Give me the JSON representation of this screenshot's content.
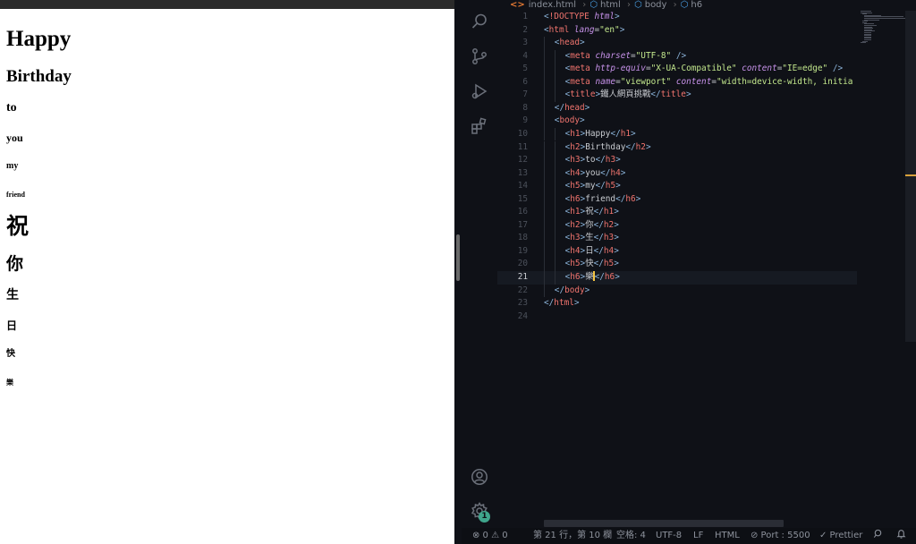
{
  "browser": {
    "headings": [
      {
        "tag": "h1",
        "text": "Happy"
      },
      {
        "tag": "h2",
        "text": "Birthday"
      },
      {
        "tag": "h3",
        "text": "to"
      },
      {
        "tag": "h4",
        "text": "you"
      },
      {
        "tag": "h5",
        "text": "my"
      },
      {
        "tag": "h6",
        "text": "friend"
      },
      {
        "tag": "h1",
        "text": "祝"
      },
      {
        "tag": "h2",
        "text": "你"
      },
      {
        "tag": "h3",
        "text": "生"
      },
      {
        "tag": "h4",
        "text": "日"
      },
      {
        "tag": "h5",
        "text": "快"
      },
      {
        "tag": "h6",
        "text": "樂"
      }
    ]
  },
  "breadcrumb": {
    "file_icon": "<>",
    "file": "index.html",
    "items": [
      "html",
      "body",
      "h6"
    ]
  },
  "activity_bar": {
    "icons": [
      "search-icon",
      "source-control-icon",
      "run-debug-icon",
      "extensions-icon",
      "account-icon",
      "settings-gear-icon"
    ],
    "badge": "1"
  },
  "editor": {
    "current_line": 21,
    "line_numbers": [
      "1",
      "2",
      "3",
      "4",
      "5",
      "6",
      "7",
      "8",
      "9",
      "10",
      "11",
      "12",
      "13",
      "14",
      "15",
      "16",
      "17",
      "18",
      "19",
      "20",
      "21",
      "22",
      "23",
      "24"
    ],
    "lines": [
      {
        "indent": 0,
        "tokens": [
          [
            "br",
            "<"
          ],
          [
            "tag",
            "!DOCTYPE "
          ],
          [
            "attr",
            "html"
          ],
          [
            "br",
            ">"
          ]
        ]
      },
      {
        "indent": 0,
        "tokens": [
          [
            "br",
            "<"
          ],
          [
            "tag",
            "html "
          ],
          [
            "attr",
            "lang"
          ],
          [
            "text",
            "="
          ],
          [
            "str",
            "\"en\""
          ],
          [
            "br",
            ">"
          ]
        ]
      },
      {
        "indent": 1,
        "tokens": [
          [
            "br",
            "<"
          ],
          [
            "tag",
            "head"
          ],
          [
            "br",
            ">"
          ]
        ]
      },
      {
        "indent": 2,
        "tokens": [
          [
            "br",
            "<"
          ],
          [
            "tag",
            "meta "
          ],
          [
            "attr",
            "charset"
          ],
          [
            "text",
            "="
          ],
          [
            "str",
            "\"UTF-8\""
          ],
          [
            "br",
            " />"
          ]
        ]
      },
      {
        "indent": 2,
        "tokens": [
          [
            "br",
            "<"
          ],
          [
            "tag",
            "meta "
          ],
          [
            "attr",
            "http-equiv"
          ],
          [
            "text",
            "="
          ],
          [
            "str",
            "\"X-UA-Compatible\""
          ],
          [
            "text",
            " "
          ],
          [
            "attr",
            "content"
          ],
          [
            "text",
            "="
          ],
          [
            "str",
            "\"IE=edge\""
          ],
          [
            "br",
            " />"
          ]
        ]
      },
      {
        "indent": 2,
        "tokens": [
          [
            "br",
            "<"
          ],
          [
            "tag",
            "meta "
          ],
          [
            "attr",
            "name"
          ],
          [
            "text",
            "="
          ],
          [
            "str",
            "\"viewport\""
          ],
          [
            "text",
            " "
          ],
          [
            "attr",
            "content"
          ],
          [
            "text",
            "="
          ],
          [
            "str",
            "\"width=device-width, initia"
          ]
        ]
      },
      {
        "indent": 2,
        "tokens": [
          [
            "br",
            "<"
          ],
          [
            "tag",
            "title"
          ],
          [
            "br",
            ">"
          ],
          [
            "text",
            "鐵人網頁挑戰"
          ],
          [
            "br",
            "</"
          ],
          [
            "tag",
            "title"
          ],
          [
            "br",
            ">"
          ]
        ]
      },
      {
        "indent": 1,
        "tokens": [
          [
            "br",
            "</"
          ],
          [
            "tag",
            "head"
          ],
          [
            "br",
            ">"
          ]
        ]
      },
      {
        "indent": 1,
        "tokens": [
          [
            "br",
            "<"
          ],
          [
            "tag",
            "body"
          ],
          [
            "br",
            ">"
          ]
        ]
      },
      {
        "indent": 2,
        "tokens": [
          [
            "br",
            "<"
          ],
          [
            "tag",
            "h1"
          ],
          [
            "br",
            ">"
          ],
          [
            "text",
            "Happy"
          ],
          [
            "br",
            "</"
          ],
          [
            "tag",
            "h1"
          ],
          [
            "br",
            ">"
          ]
        ]
      },
      {
        "indent": 2,
        "tokens": [
          [
            "br",
            "<"
          ],
          [
            "tag",
            "h2"
          ],
          [
            "br",
            ">"
          ],
          [
            "text",
            "Birthday"
          ],
          [
            "br",
            "</"
          ],
          [
            "tag",
            "h2"
          ],
          [
            "br",
            ">"
          ]
        ]
      },
      {
        "indent": 2,
        "tokens": [
          [
            "br",
            "<"
          ],
          [
            "tag",
            "h3"
          ],
          [
            "br",
            ">"
          ],
          [
            "text",
            "to"
          ],
          [
            "br",
            "</"
          ],
          [
            "tag",
            "h3"
          ],
          [
            "br",
            ">"
          ]
        ]
      },
      {
        "indent": 2,
        "tokens": [
          [
            "br",
            "<"
          ],
          [
            "tag",
            "h4"
          ],
          [
            "br",
            ">"
          ],
          [
            "text",
            "you"
          ],
          [
            "br",
            "</"
          ],
          [
            "tag",
            "h4"
          ],
          [
            "br",
            ">"
          ]
        ]
      },
      {
        "indent": 2,
        "tokens": [
          [
            "br",
            "<"
          ],
          [
            "tag",
            "h5"
          ],
          [
            "br",
            ">"
          ],
          [
            "text",
            "my"
          ],
          [
            "br",
            "</"
          ],
          [
            "tag",
            "h5"
          ],
          [
            "br",
            ">"
          ]
        ]
      },
      {
        "indent": 2,
        "tokens": [
          [
            "br",
            "<"
          ],
          [
            "tag",
            "h6"
          ],
          [
            "br",
            ">"
          ],
          [
            "text",
            "friend"
          ],
          [
            "br",
            "</"
          ],
          [
            "tag",
            "h6"
          ],
          [
            "br",
            ">"
          ]
        ]
      },
      {
        "indent": 2,
        "tokens": [
          [
            "br",
            "<"
          ],
          [
            "tag",
            "h1"
          ],
          [
            "br",
            ">"
          ],
          [
            "text",
            "祝"
          ],
          [
            "br",
            "</"
          ],
          [
            "tag",
            "h1"
          ],
          [
            "br",
            ">"
          ]
        ]
      },
      {
        "indent": 2,
        "tokens": [
          [
            "br",
            "<"
          ],
          [
            "tag",
            "h2"
          ],
          [
            "br",
            ">"
          ],
          [
            "text",
            "你"
          ],
          [
            "br",
            "</"
          ],
          [
            "tag",
            "h2"
          ],
          [
            "br",
            ">"
          ]
        ]
      },
      {
        "indent": 2,
        "tokens": [
          [
            "br",
            "<"
          ],
          [
            "tag",
            "h3"
          ],
          [
            "br",
            ">"
          ],
          [
            "text",
            "生"
          ],
          [
            "br",
            "</"
          ],
          [
            "tag",
            "h3"
          ],
          [
            "br",
            ">"
          ]
        ]
      },
      {
        "indent": 2,
        "tokens": [
          [
            "br",
            "<"
          ],
          [
            "tag",
            "h4"
          ],
          [
            "br",
            ">"
          ],
          [
            "text",
            "日"
          ],
          [
            "br",
            "</"
          ],
          [
            "tag",
            "h4"
          ],
          [
            "br",
            ">"
          ]
        ]
      },
      {
        "indent": 2,
        "tokens": [
          [
            "br",
            "<"
          ],
          [
            "tag",
            "h5"
          ],
          [
            "br",
            ">"
          ],
          [
            "text",
            "快"
          ],
          [
            "br",
            "</"
          ],
          [
            "tag",
            "h5"
          ],
          [
            "br",
            ">"
          ]
        ]
      },
      {
        "indent": 2,
        "tokens": [
          [
            "br",
            "<"
          ],
          [
            "tag",
            "h6"
          ],
          [
            "br",
            ">"
          ],
          [
            "text",
            "樂"
          ],
          [
            "caret",
            ""
          ],
          [
            "br",
            "</"
          ],
          [
            "tag",
            "h6"
          ],
          [
            "br",
            ">"
          ]
        ]
      },
      {
        "indent": 1,
        "tokens": [
          [
            "br",
            "</"
          ],
          [
            "tag",
            "body"
          ],
          [
            "br",
            ">"
          ]
        ]
      },
      {
        "indent": 0,
        "tokens": [
          [
            "br",
            "</"
          ],
          [
            "tag",
            "html"
          ],
          [
            "br",
            ">"
          ]
        ]
      },
      {
        "indent": 0,
        "tokens": []
      }
    ]
  },
  "statusbar": {
    "problems": "⊗ 0 ⚠ 0",
    "position": "第 21 行，第 10 欄",
    "spaces": "空格: 4",
    "encoding": "UTF-8",
    "eol": "LF",
    "language": "HTML",
    "port": "⊘ Port : 5500",
    "prettier": "✓ Prettier",
    "feedback_icon": "feedback-icon",
    "bell_icon": "bell-icon"
  }
}
